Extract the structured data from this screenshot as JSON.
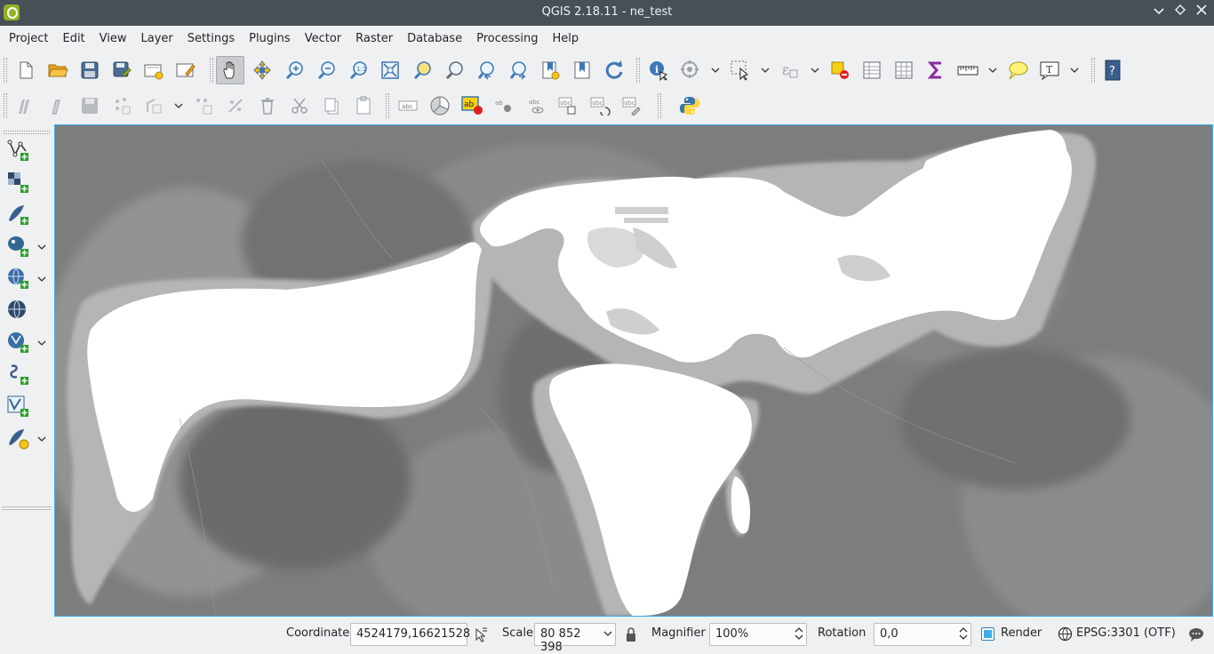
{
  "window": {
    "title": "QGIS 2.18.11 - ne_test",
    "controls": [
      "minimize",
      "maximize",
      "close"
    ]
  },
  "menu": [
    "Project",
    "Edit",
    "View",
    "Layer",
    "Settings",
    "Plugins",
    "Vector",
    "Raster",
    "Database",
    "Processing",
    "Help"
  ],
  "toolbar_row1_icons": [
    "new-project-icon",
    "open-project-icon",
    "save-project-icon",
    "save-as-icon",
    "new-print-composer-icon",
    "composer-manager-icon",
    "pan-icon",
    "pan-to-selection-icon",
    "zoom-in-icon",
    "zoom-out-icon",
    "zoom-native-icon",
    "zoom-full-icon",
    "zoom-to-selection-icon",
    "zoom-to-layer-icon",
    "zoom-last-icon",
    "zoom-next-icon",
    "new-bookmark-icon",
    "show-bookmarks-icon",
    "refresh-icon",
    "identify-icon",
    "map-tips-icon",
    "select-features-icon",
    "select-by-expression-icon",
    "deselect-icon",
    "attribute-table-icon",
    "field-calculator-icon",
    "statistics-sigma-icon",
    "measure-line-icon",
    "annotation-icon",
    "text-annotation-icon",
    "help-icon"
  ],
  "toolbar_row2_icons": [
    "current-edits-icon",
    "toggle-editing-icon",
    "save-edits-icon",
    "add-feature-icon",
    "move-feature-icon",
    "node-tool-icon",
    "delete-selected-icon",
    "cut-features-icon",
    "copy-features-icon",
    "paste-features-icon",
    "label-toolbar-icon",
    "diagram-toolbar-icon",
    "layer-labeling-icon",
    "pin-labels-icon",
    "show-hide-labels-icon",
    "move-label-icon",
    "rotate-label-icon",
    "change-label-icon",
    "python-console-icon"
  ],
  "sidebar_icons": [
    "add-vector-layer-icon",
    "add-raster-layer-icon",
    "add-spatialite-layer-icon",
    "add-postgis-layer-icon",
    "add-wms-layer-icon",
    "add-wcs-layer-icon",
    "add-wfs-layer-icon",
    "add-delimited-text-icon",
    "add-virtual-layer-icon",
    "new-shapefile-icon"
  ],
  "status": {
    "coordinate_label": "Coordinate",
    "coordinate_value": "4524179,16621528",
    "scale_label": "Scale",
    "scale_value": "80 852 398",
    "magnifier_label": "Magnifier",
    "magnifier_value": "100%",
    "rotation_label": "Rotation",
    "rotation_value": "0,0",
    "render_label": "Render",
    "render_checked": true,
    "crs": "EPSG:3301 (OTF)"
  },
  "colors": {
    "titlebar": "#475057",
    "window_bg": "#eff0f1",
    "accent": "#3daee9",
    "qgis_green": "#93b023",
    "map_land": "#ffffff",
    "map_ocean_deep": "#7f7f7f"
  }
}
